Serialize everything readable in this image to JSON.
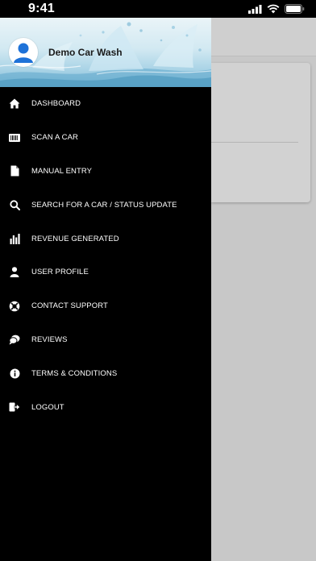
{
  "status_bar": {
    "time": "9:41",
    "icons": [
      "cellular-icon",
      "wifi-icon",
      "battery-icon"
    ]
  },
  "drawer": {
    "header": {
      "business_name": "Demo Car Wash",
      "avatar_icon": "person-icon"
    },
    "items": [
      {
        "label": "DASHBOARD",
        "icon": "home-icon"
      },
      {
        "label": "SCAN A CAR",
        "icon": "barcode-icon"
      },
      {
        "label": "MANUAL ENTRY",
        "icon": "document-icon"
      },
      {
        "label": "SEARCH FOR A CAR / STATUS UPDATE",
        "icon": "search-icon"
      },
      {
        "label": "REVENUE GENERATED",
        "icon": "bar-chart-icon"
      },
      {
        "label": "USER PROFILE",
        "icon": "user-icon"
      },
      {
        "label": "CONTACT SUPPORT",
        "icon": "life-ring-icon"
      },
      {
        "label": "REVIEWS",
        "icon": "chat-bubbles-icon"
      },
      {
        "label": "TERMS & CONDITIONS",
        "icon": "info-icon"
      },
      {
        "label": "LOGOUT",
        "icon": "logout-icon"
      }
    ]
  },
  "colors": {
    "drawer_bg": "#000000",
    "avatar_accent": "#1e72d8",
    "scrim": "#c8c8c8"
  }
}
